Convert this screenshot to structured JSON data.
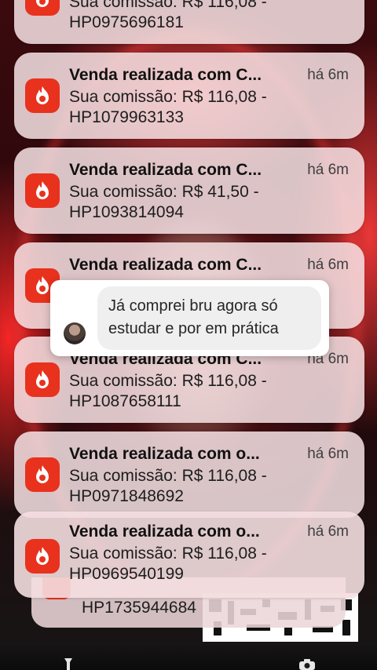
{
  "notifications": [
    {
      "title": "",
      "time": "",
      "line1": "Sua comissão: R$ 116,08 -",
      "line2": "HP0975696181"
    },
    {
      "title": "Venda realizada com C...",
      "time": "há 6m",
      "line1": "Sua comissão: R$ 116,08 -",
      "line2": "HP1079963133"
    },
    {
      "title": "Venda realizada com C...",
      "time": "há 6m",
      "line1": "Sua comissão: R$ 41,50 -",
      "line2": "HP1093814094"
    },
    {
      "title": "Venda realizada com C...",
      "time": "há 6m",
      "line1": "",
      "line2": ""
    },
    {
      "title": "Venda realizada com C...",
      "time": "há 6m",
      "line1": "Sua comissão: R$ 116,08 -",
      "line2": "HP1087658111"
    },
    {
      "title": "Venda realizada com o...",
      "time": "há 6m",
      "line1": "Sua comissão: R$ 116,08 -",
      "line2": "HP0971848692"
    },
    {
      "title": "Venda realizada com o...",
      "time": "há 6m",
      "line1": "Sua comissão: R$ 116,08 -",
      "line2": "HP0969540199"
    },
    {
      "title": "",
      "time": "",
      "line1": "",
      "line2": "HP1735944684"
    }
  ],
  "comment": {
    "text": "Já comprei bru agora só estudar e por em prática"
  },
  "icons": {
    "app": "hotmart-flame-icon",
    "avatar": "user-avatar",
    "bottom_left": "flashlight-icon",
    "bottom_right": "camera-icon"
  },
  "colors": {
    "app_icon": "#e8321e",
    "notification_bg": "#f6e2e4",
    "comment_bg": "#ffffff",
    "bubble_bg": "#efefef"
  }
}
